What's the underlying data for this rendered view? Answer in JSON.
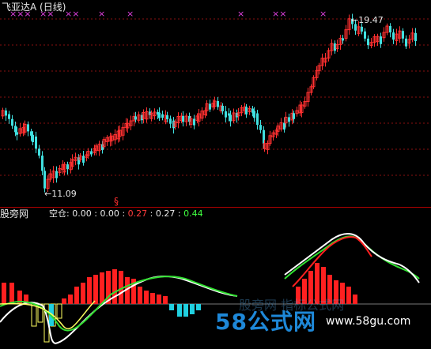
{
  "window": {
    "title": "飞亚达A (日线)"
  },
  "main_chart": {
    "signal_marks": [
      "×××",
      "××",
      "××",
      "×",
      "×",
      "×",
      "××",
      "×"
    ],
    "high_label": "←19.47",
    "low_label": "←11.09",
    "signal_symbol": "§",
    "colors": {
      "up": "#ff3030",
      "down": "#40e0e0",
      "grid": "#8a1010",
      "mark": "#e040e0"
    }
  },
  "indicator": {
    "source": "股旁网",
    "name": "空仓:",
    "values": [
      "0.00",
      "0.00",
      "0.27",
      "0.27",
      "0.44"
    ],
    "colors": {
      "white_line": "#ffffff",
      "green_line": "#30e030",
      "red_line": "#ff2020",
      "bars_pos": "#ff2020",
      "bars_neg": "#20d0e0",
      "bars_yellow": "#ffff60"
    }
  },
  "watermark": {
    "brand": "58公式网",
    "url": "www.58gu.com",
    "ghost_text": "股旁网 指标公式网"
  },
  "chart_data": {
    "type": "line",
    "title": "飞亚达A (日线)",
    "price_high": 19.47,
    "price_low": 11.09,
    "indicator_values": [
      0.0,
      0.0,
      0.27,
      0.27,
      0.44
    ]
  }
}
